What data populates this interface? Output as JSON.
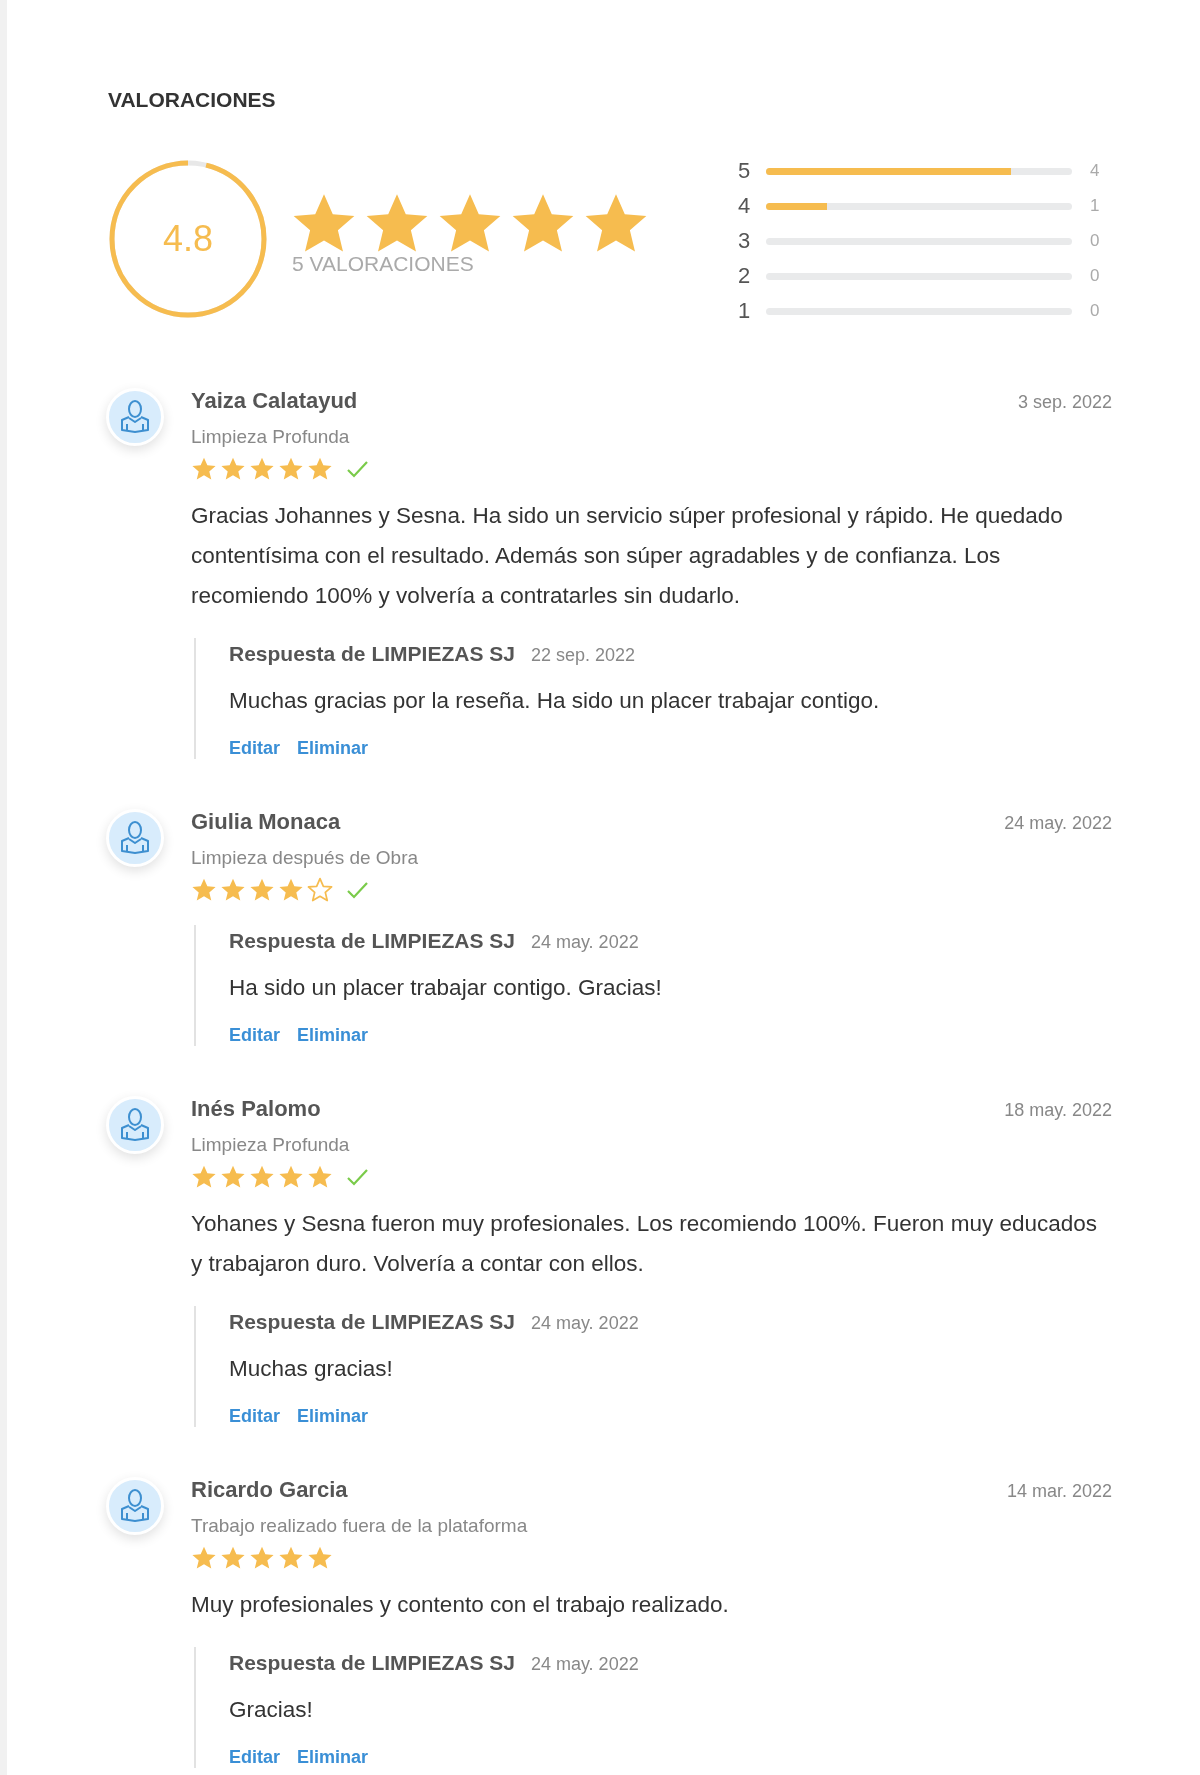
{
  "title": "VALORACIONES",
  "summary": {
    "rating": "4.8",
    "stars": 5,
    "count_label": "5 VALORACIONES"
  },
  "distribution": [
    {
      "label": "5",
      "level": 0.8,
      "count": "4"
    },
    {
      "label": "4",
      "level": 0.2,
      "count": "1"
    },
    {
      "label": "3",
      "level": 0,
      "count": "0"
    },
    {
      "label": "2",
      "level": 0,
      "count": "0"
    },
    {
      "label": "1",
      "level": 0,
      "count": "0"
    }
  ],
  "reviews": [
    {
      "name": "Yaiza Calatayud",
      "service": "Limpieza Profunda",
      "date": "3 sep. 2022",
      "stars": 5,
      "verified": true,
      "text": "Gracias Johannes y Sesna. Ha sido un servicio súper profesional y rápido. He quedado contentísima con el resultado. Además son súper agradables y de confianza. Los recomiendo 100% y volvería a contratarles sin dudarlo.",
      "reply": {
        "author": "Respuesta de LIMPIEZAS SJ",
        "date": "22 sep. 2022",
        "text": "Muchas gracias por la reseña. Ha sido un placer trabajar contigo.",
        "actions": [
          "Editar",
          "Eliminar"
        ]
      }
    },
    {
      "name": "Giulia Monaca",
      "service": "Limpieza después de Obra",
      "date": "24 may. 2022",
      "stars": 4,
      "verified": true,
      "reply": {
        "author": "Respuesta de LIMPIEZAS SJ",
        "date": "24 may. 2022",
        "text": "Ha sido un placer trabajar contigo. Gracias!",
        "actions": [
          "Editar",
          "Eliminar"
        ]
      }
    },
    {
      "name": "Inés Palomo",
      "service": "Limpieza Profunda",
      "date": "18 may. 2022",
      "stars": 5,
      "verified": true,
      "text": "Yohanes y Sesna fueron muy profesionales. Los recomiendo 100%. Fueron muy educados y trabajaron duro. Volvería a contar con ellos.",
      "reply": {
        "author": "Respuesta de LIMPIEZAS SJ",
        "date": "24 may. 2022",
        "text": "Muchas gracias!",
        "actions": [
          "Editar",
          "Eliminar"
        ]
      }
    },
    {
      "name": "Ricardo Garcia",
      "service": "Trabajo realizado fuera de la plataforma",
      "date": "14 mar. 2022",
      "stars": 5,
      "verified": false,
      "text": "Muy profesionales y contento con el trabajo realizado.",
      "reply": {
        "author": "Respuesta de LIMPIEZAS SJ",
        "date": "24 may. 2022",
        "text": "Gracias!",
        "actions": [
          "Editar",
          "Eliminar"
        ]
      }
    }
  ]
}
